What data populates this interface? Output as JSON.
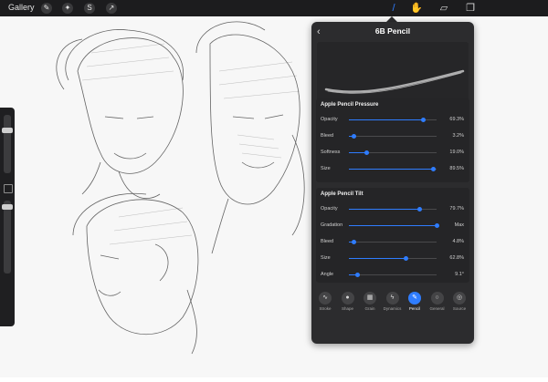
{
  "topbar": {
    "gallery_label": "Gallery",
    "left_tools": [
      {
        "name": "wrench-icon",
        "glyph": "✎"
      },
      {
        "name": "magic-wand-icon",
        "glyph": "✦"
      },
      {
        "name": "selection-icon",
        "glyph": "S"
      },
      {
        "name": "transform-icon",
        "glyph": "↗"
      }
    ],
    "right_tools": [
      {
        "name": "brush-icon",
        "glyph": "/"
      },
      {
        "name": "smudge-icon",
        "glyph": "✋"
      },
      {
        "name": "eraser-icon",
        "glyph": "▱"
      },
      {
        "name": "layers-icon",
        "glyph": "❐"
      }
    ]
  },
  "panel": {
    "title": "6B Pencil",
    "pressure_section": {
      "title": "Apple Pencil Pressure",
      "rows": [
        {
          "label": "Opacity",
          "value": "69.3%",
          "fraction": 0.84
        },
        {
          "label": "Bleed",
          "value": "3.2%",
          "fraction": 0.05
        },
        {
          "label": "Softness",
          "value": "19.0%",
          "fraction": 0.2
        },
        {
          "label": "Size",
          "value": "89.5%",
          "fraction": 0.96
        }
      ]
    },
    "tilt_section": {
      "title": "Apple Pencil Tilt",
      "rows": [
        {
          "label": "Opacity",
          "value": "79.7%",
          "fraction": 0.8
        },
        {
          "label": "Gradation",
          "value": "Max",
          "fraction": 1.0
        },
        {
          "label": "Bleed",
          "value": "4.8%",
          "fraction": 0.05
        },
        {
          "label": "Size",
          "value": "62.8%",
          "fraction": 0.65
        },
        {
          "label": "Angle",
          "value": "9.1°",
          "fraction": 0.09
        }
      ]
    },
    "tabs": [
      {
        "label": "Stroke",
        "glyph": "∿",
        "active": false
      },
      {
        "label": "Shape",
        "glyph": "●",
        "active": false
      },
      {
        "label": "Grain",
        "glyph": "▦",
        "active": false
      },
      {
        "label": "Dynamics",
        "glyph": "ϟ",
        "active": false
      },
      {
        "label": "Pencil",
        "glyph": "✎",
        "active": true
      },
      {
        "label": "General",
        "glyph": "○",
        "active": false
      },
      {
        "label": "Source",
        "glyph": "◎",
        "active": false
      }
    ]
  },
  "colors": {
    "accent": "#2f7dff",
    "panel_bg": "#2c2c2e",
    "topbar_bg": "#1c1c1e"
  }
}
